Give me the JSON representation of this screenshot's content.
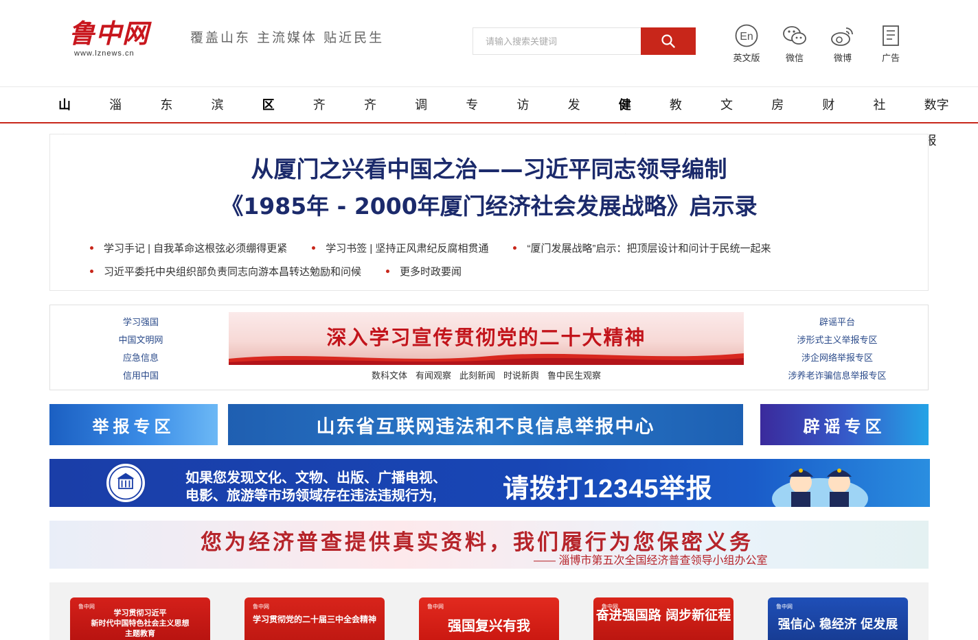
{
  "header": {
    "logo_text": "鲁中网",
    "logo_url": "www.lznews.cn",
    "slogan": "覆盖山东  主流媒体  贴近民生",
    "search_placeholder": "请输入搜索关键词",
    "tools": [
      {
        "label": "英文版",
        "icon": "english-icon"
      },
      {
        "label": "微信",
        "icon": "wechat-icon"
      },
      {
        "label": "微博",
        "icon": "weibo-icon"
      },
      {
        "label": "广告",
        "icon": "ad-icon"
      }
    ]
  },
  "nav": {
    "items": [
      "山东",
      "淄博",
      "东营",
      "滨州",
      "区县",
      "齐评",
      "齐观",
      "调查",
      "专题",
      "访谈",
      "发布",
      "健康",
      "教育",
      "文旅",
      "房产",
      "财经",
      "社会",
      "数字报"
    ],
    "bold_items": [
      "山东",
      "区县",
      "健康"
    ]
  },
  "headline": {
    "line1": "从厦门之兴看中国之治——习近平同志领导编制",
    "line2": "《1985年 - 2000年厦门经济社会发展战略》启示录",
    "links_row1": [
      "学习手记 | 自我革命这根弦必须绷得更紧",
      "学习书签 | 坚持正风肃纪反腐相贯通",
      "“厦门发展战略”启示：把顶层设计和问计于民统一起来"
    ],
    "links_row2": [
      "习近平委托中央组织部负责同志向游本昌转达勉励和问候",
      "更多时政要闻"
    ]
  },
  "banner_panel": {
    "left_links": [
      "学习强国",
      "中国文明网",
      "应急信息",
      "信用中国"
    ],
    "right_links": [
      "辟谣平台",
      "涉形式主义举报专区",
      "涉企网络举报专区",
      "涉养老诈骗信息举报专区"
    ],
    "center_title": "深入学习宣传贯彻党的二十大精神",
    "sub_links": [
      "数科文体",
      "有闻观察",
      "此刻新闻",
      "时说新舆",
      "鲁中民生观察"
    ]
  },
  "report": {
    "left": "举报专区",
    "mid": "山东省互联网违法和不良信息举报中心",
    "right": "辟谣专区"
  },
  "hotline": {
    "line1": "如果您发现文化、文物、出版、广播电视、",
    "line2": "电影、旅游等市场领域存在违法违规行为,",
    "big": "请拨打12345举报"
  },
  "census": {
    "title": "您为经济普查提供真实资料，我们履行为您保密义务",
    "sub": "—— 淄博市第五次全国经济普查领导小组办公室"
  },
  "topics": [
    {
      "text": "学习贯彻习近平\n新时代中国特色社会主义思想\n主题教育"
    },
    {
      "text": "学习贯彻党的二十届三中全会精神"
    },
    {
      "text": "强国复兴有我"
    },
    {
      "text": "奋进强国路 阔步新征程"
    },
    {
      "text": "强信心 稳经济 促发展"
    }
  ],
  "colors": {
    "brand_red": "#c8261a",
    "headline_navy": "#1b2a6b",
    "link_blue": "#2a4a8a"
  }
}
